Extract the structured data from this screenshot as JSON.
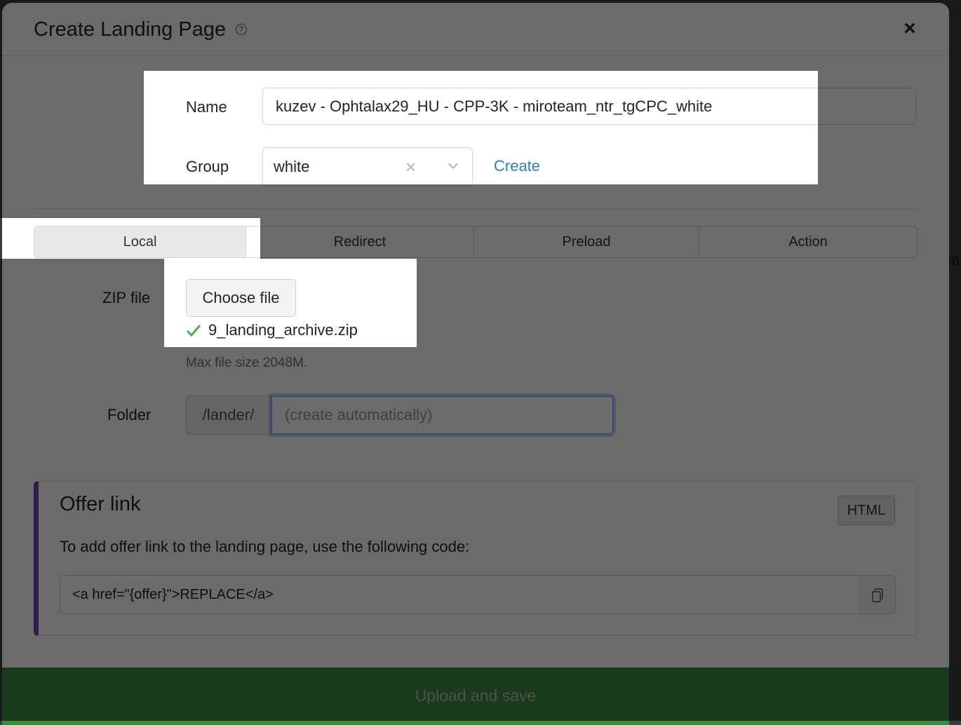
{
  "modal": {
    "title": "Create Landing Page",
    "help_icon": "?",
    "close_icon": "×"
  },
  "form": {
    "name_label": "Name",
    "name_value": "kuzev - Ophtalax29_HU - CPP-3K - miroteam_ntr_tgCPC_white",
    "group_label": "Group",
    "group_value": "white",
    "group_clear_icon": "×",
    "create_link": "Create"
  },
  "tabs": [
    {
      "label": "Local",
      "active": true
    },
    {
      "label": "Redirect",
      "active": false
    },
    {
      "label": "Preload",
      "active": false
    },
    {
      "label": "Action",
      "active": false
    }
  ],
  "upload": {
    "zip_label": "ZIP file",
    "choose_button": "Choose file",
    "file_name": "9_landing_archive.zip",
    "hint": "Max file size 2048M.",
    "folder_label": "Folder",
    "folder_prefix": "/lander/",
    "folder_placeholder": "(create automatically)"
  },
  "offer": {
    "title": "Offer link",
    "badge": "HTML",
    "description": "To add offer link to the landing page, use the following code:",
    "code": "<a href=\"{offer}\">REPLACE</a>"
  },
  "footer": {
    "submit_label": "Upload and save"
  },
  "background": {
    "edge_text": "m"
  },
  "colors": {
    "accent_link": "#2f7fc1",
    "submit_bg": "#3c8c40",
    "offer_border": "#6f42c1",
    "success_check": "#4caf50"
  }
}
